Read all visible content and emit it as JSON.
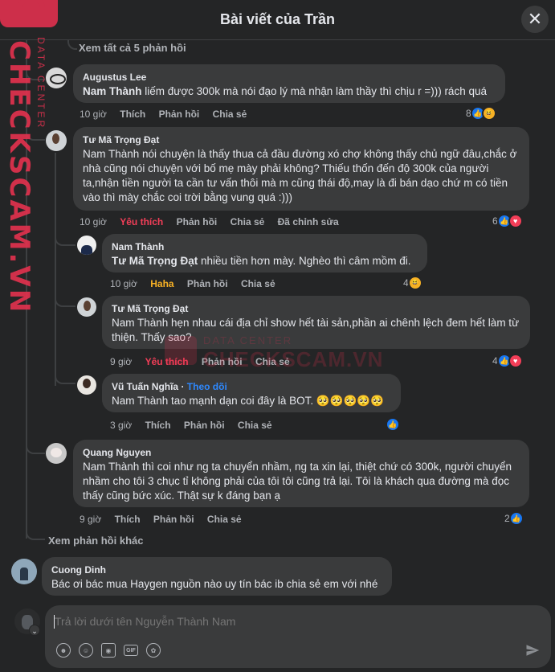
{
  "header": {
    "title": "Bài viết của Trần",
    "close_icon": "close-icon"
  },
  "watermark": {
    "brand": "CHECKSCAM.VN",
    "sub": "DATA CENTER"
  },
  "view_all_replies": "Xem tất cả 5 phản hồi",
  "view_more_replies": "Xem phản hồi khác",
  "comments": [
    {
      "author": "Augustus Lee",
      "mention": "Nam Thành",
      "text": " liếm được 300k mà nói đạo lý mà nhận làm thầy thì chịu r =))) rách quá",
      "time": "10 giờ",
      "like": "Thích",
      "reply": "Phản hồi",
      "share": "Chia sẻ",
      "reaction_count": "8",
      "reactions": [
        "like",
        "haha"
      ]
    },
    {
      "author": "Tư Mã Trọng Đạt",
      "mention": "",
      "text": "Nam Thành nói chuyện là thấy thua cả đầu đường xó chợ không thấy chủ ngữ đâu,chắc ở nhà cũng nói chuyện với bố mẹ mày phải không? Thiếu thốn đến độ 300k của người ta,nhận tiền người ta cần tư vấn thôi mà m cũng thái độ,may là đi bán dạo chứ m có tiền vào thì mày chắc coi trời bằng vung quá :)))",
      "time": "10 giờ",
      "like": "Yêu thích",
      "reply": "Phản hồi",
      "share": "Chia sẻ",
      "edited": "Đã chỉnh sửa",
      "reaction_count": "6",
      "reactions": [
        "like",
        "love"
      ]
    },
    {
      "author": "Nam Thành",
      "mention": "Tư Mã Trọng Đạt",
      "text": " nhiều tiền hơn mày. Nghèo thì câm mồm đi.",
      "time": "10 giờ",
      "like": "Haha",
      "reply": "Phản hồi",
      "share": "Chia sẻ",
      "reaction_count": "4",
      "reactions": [
        "haha"
      ]
    },
    {
      "author": "Tư Mã Trọng Đạt",
      "mention": "",
      "text": "Nam Thành hẹn nhau cái địa chỉ show hết tài sản,phần ai chênh lệch đem hết làm từ thiện. Thấy sao?",
      "time": "9 giờ",
      "like": "Yêu thích",
      "reply": "Phản hồi",
      "share": "Chia sẻ",
      "reaction_count": "4",
      "reactions": [
        "like",
        "love"
      ]
    },
    {
      "author": "Vũ Tuấn Nghĩa",
      "follow": "Theo dõi",
      "mention": "",
      "text": "Nam Thành tao mạnh dạn coi đây là BOT. 🥺🥺🥺🥺🥺",
      "time": "3 giờ",
      "like": "Thích",
      "reply": "Phản hồi",
      "share": "Chia sẻ",
      "reaction_count": "",
      "reactions": [
        "like"
      ]
    },
    {
      "author": "Quang Nguyen",
      "mention": "",
      "text": "Nam Thành thì coi như ng ta chuyển nhầm, ng ta xin lại, thiệt chứ có 300k, người chuyển nhầm cho tôi 3 chục tỉ không phải của tôi tôi cũng trả lại. Tôi là khách qua đường mà đọc thấy cũng bức xúc. Thật sự k đáng bạn ạ",
      "time": "9 giờ",
      "like": "Thích",
      "reply": "Phản hồi",
      "share": "Chia sẻ",
      "reaction_count": "2",
      "reactions": [
        "like"
      ]
    },
    {
      "author": "Cuong Dinh",
      "mention": "",
      "text": "Bác ơi bác mua Haygen nguồn nào uy tín bác ib chia sẻ em với nhé"
    }
  ],
  "reply_box": {
    "placeholder": "Trả lời dưới tên Nguyễn Thành Nam",
    "tools": [
      "avatar-sticker-icon",
      "emoji-icon",
      "camera-icon",
      "gif-icon",
      "sticker-icon"
    ],
    "send_icon": "send-icon"
  }
}
